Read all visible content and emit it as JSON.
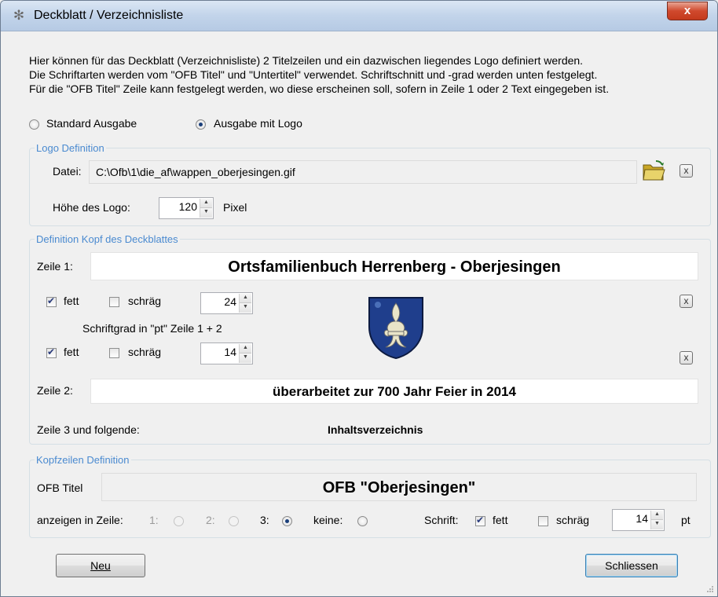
{
  "window": {
    "title": "Deckblatt / Verzeichnisliste",
    "close_label": "x"
  },
  "intro": {
    "line1": "Hier können für das Deckblatt (Verzeichnisliste) 2 Titelzeilen und ein dazwischen liegendes Logo definiert werden.",
    "line2": "Die Schriftarten werden vom \"OFB Titel\" und \"Untertitel\" verwendet. Schriftschnitt und -grad werden unten festgelegt.",
    "line3": "Für die \"OFB Titel\" Zeile kann festgelegt werden, wo diese erscheinen soll, sofern in Zeile 1 oder 2 Text eingegeben ist."
  },
  "output_mode": {
    "standard_label": "Standard Ausgabe",
    "logo_label": "Ausgabe mit Logo",
    "selected": "logo"
  },
  "logo_definition": {
    "group_title": "Logo Definition",
    "file_label": "Datei:",
    "file_value": "C:\\Ofb\\1\\die_af\\wappen_oberjesingen.gif",
    "height_label": "Höhe des Logo:",
    "height_value": "120",
    "height_unit": "Pixel",
    "clear_label": "x"
  },
  "kopf": {
    "group_title": "Definition Kopf des Deckblattes",
    "zeile1_label": "Zeile 1:",
    "zeile1_value": "Ortsfamilienbuch Herrenberg - Oberjesingen",
    "fett_label": "fett",
    "schraeg_label": "schräg",
    "row1_size": "24",
    "row1_fett": true,
    "row1_schraeg": false,
    "schriftgrad_label": "Schriftgrad in \"pt\" Zeile 1 + 2",
    "row2_size": "14",
    "row2_fett": true,
    "row2_schraeg": false,
    "zeile2_label": "Zeile 2:",
    "zeile2_value": "überarbeitet zur 700 Jahr Feier in 2014",
    "zeile3_label": "Zeile 3 und folgende:",
    "zeile3_value": "Inhaltsverzeichnis",
    "clear_label": "x"
  },
  "kopfzeilen": {
    "group_title": "Kopfzeilen Definition",
    "ofb_titel_label": "OFB Titel",
    "ofb_titel_value": "OFB \"Oberjesingen\"",
    "anzeigen_label": "anzeigen in Zeile:",
    "opt1_label": "1:",
    "opt2_label": "2:",
    "opt3_label": "3:",
    "keine_label": "keine:",
    "selected": "3",
    "schrift_label": "Schrift:",
    "fett_label": "fett",
    "schraeg_label": "schräg",
    "fett_checked": true,
    "schraeg_checked": false,
    "size_value": "14",
    "size_unit": "pt"
  },
  "buttons": {
    "neu_label": "Neu",
    "schliessen_label": "Schliessen"
  },
  "colors": {
    "group_title": "#4a8ad0",
    "close_button": "#c53a1d",
    "coat_of_arms_blue": "#1f3e8c",
    "coat_of_arms_fleur": "#e9e4c8"
  }
}
